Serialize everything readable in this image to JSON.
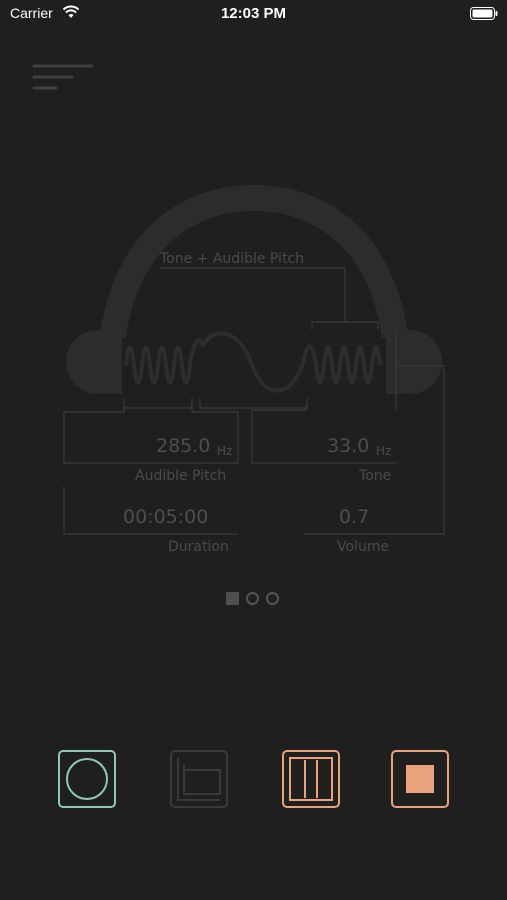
{
  "status": {
    "carrier": "Carrier",
    "time": "12:03 PM"
  },
  "diagram": {
    "title": "Tone + Audible Pitch",
    "audible_pitch": {
      "value": "285.0",
      "unit": "Hz",
      "label": "Audible Pitch"
    },
    "tone": {
      "value": "33.0",
      "unit": "Hz",
      "label": "Tone"
    },
    "duration": {
      "value": "00:05:00",
      "label": "Duration"
    },
    "volume": {
      "value": "0.7",
      "label": "Volume"
    }
  },
  "pager": {
    "pages": 3,
    "current": 1
  },
  "controls": {
    "colors": {
      "record": "#8fc9b9",
      "disabled": "#3a3a3a",
      "accent": "#e8a27d"
    },
    "icons": [
      "record-icon",
      "graph-icon",
      "pause-icon",
      "stop-icon"
    ]
  }
}
